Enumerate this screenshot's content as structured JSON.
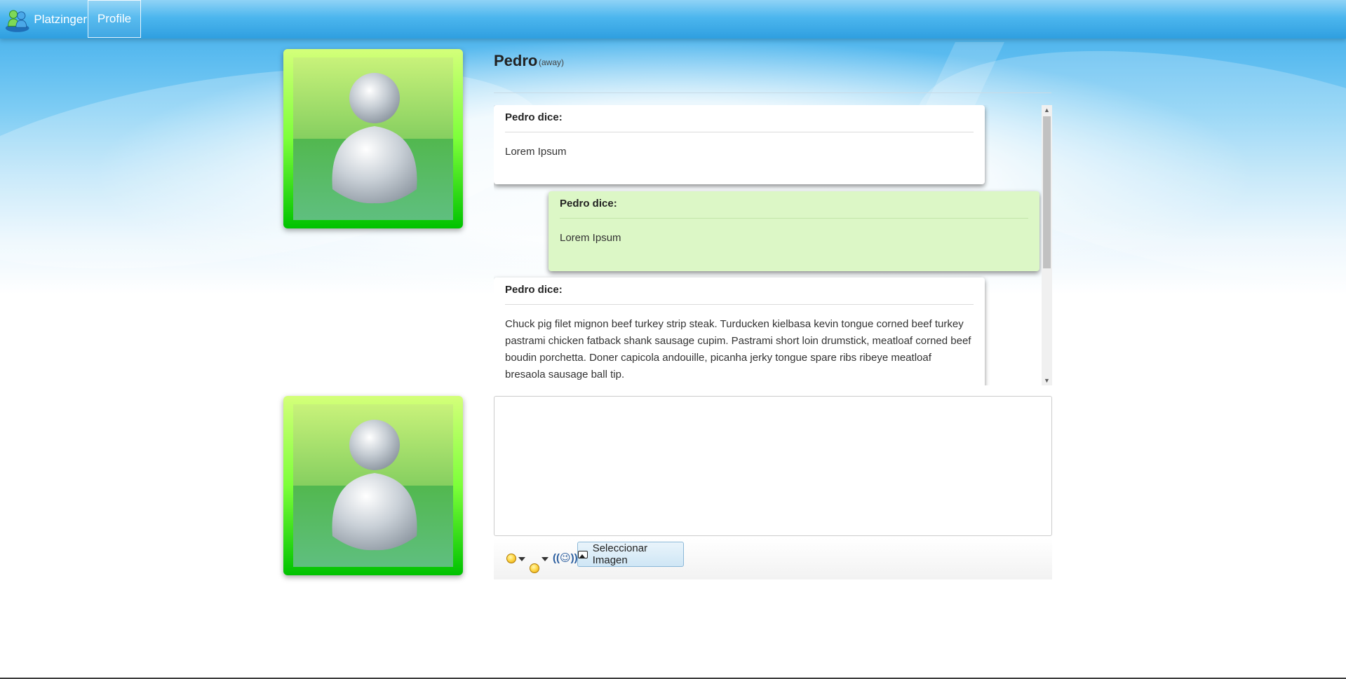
{
  "navbar": {
    "brand_label": "Platzinger",
    "profile_label": "Profile"
  },
  "contact": {
    "name": "Pedro",
    "status": "(away)"
  },
  "messages": [
    {
      "author": "Pedro dice:",
      "text": "Lorem Ipsum"
    },
    {
      "author": "Pedro dice:",
      "text": "Lorem Ipsum"
    },
    {
      "author": "Pedro dice:",
      "text": "Chuck pig filet mignon beef turkey strip steak. Turducken kielbasa kevin tongue corned beef turkey pastrami chicken fatback shank sausage cupim. Pastrami short loin drumstick, meatloaf corned beef boudin porchetta. Doner capicola andouille, picanha jerky tongue spare ribs ribeye meatloaf bresaola sausage ball tip."
    }
  ],
  "composer": {
    "input_value": "",
    "nudge_label": "((😉))",
    "select_image_label": "Seleccionar Imagen"
  },
  "colors": {
    "navbar": "#2f9fe0",
    "own_message_bg": "#dcf7c6",
    "avatar_green": "#00c800"
  }
}
